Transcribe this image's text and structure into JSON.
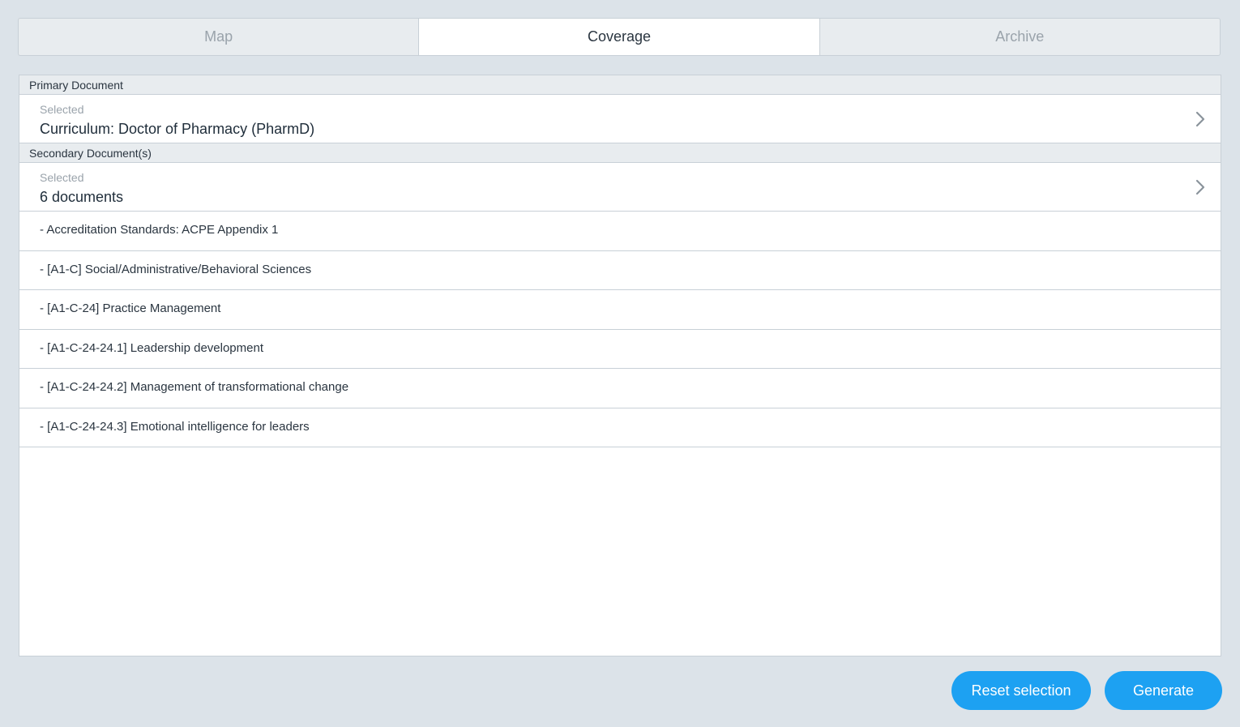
{
  "tabs": [
    {
      "label": "Map",
      "active": false
    },
    {
      "label": "Coverage",
      "active": true
    },
    {
      "label": "Archive",
      "active": false
    }
  ],
  "primary": {
    "header": "Primary Document",
    "caption": "Selected",
    "value": "Curriculum: Doctor of Pharmacy (PharmD)",
    "icon": "chevron-right-icon"
  },
  "secondary": {
    "header": "Secondary Document(s)",
    "caption": "Selected",
    "value": "6 documents",
    "icon": "chevron-right-icon",
    "items": [
      "- Accreditation Standards: ACPE Appendix 1",
      "- [A1-C] Social/Administrative/Behavioral Sciences",
      "- [A1-C-24] Practice Management",
      "- [A1-C-24-24.1] Leadership development",
      "- [A1-C-24-24.2] Management of transformational change",
      "- [A1-C-24-24.3] Emotional intelligence for leaders"
    ]
  },
  "actions": {
    "reset_label": "Reset selection",
    "generate_label": "Generate"
  },
  "colors": {
    "background": "#dce3e9",
    "accent": "#1da1f2",
    "border": "#c8d0d7",
    "header_bg": "#e8ecef"
  }
}
